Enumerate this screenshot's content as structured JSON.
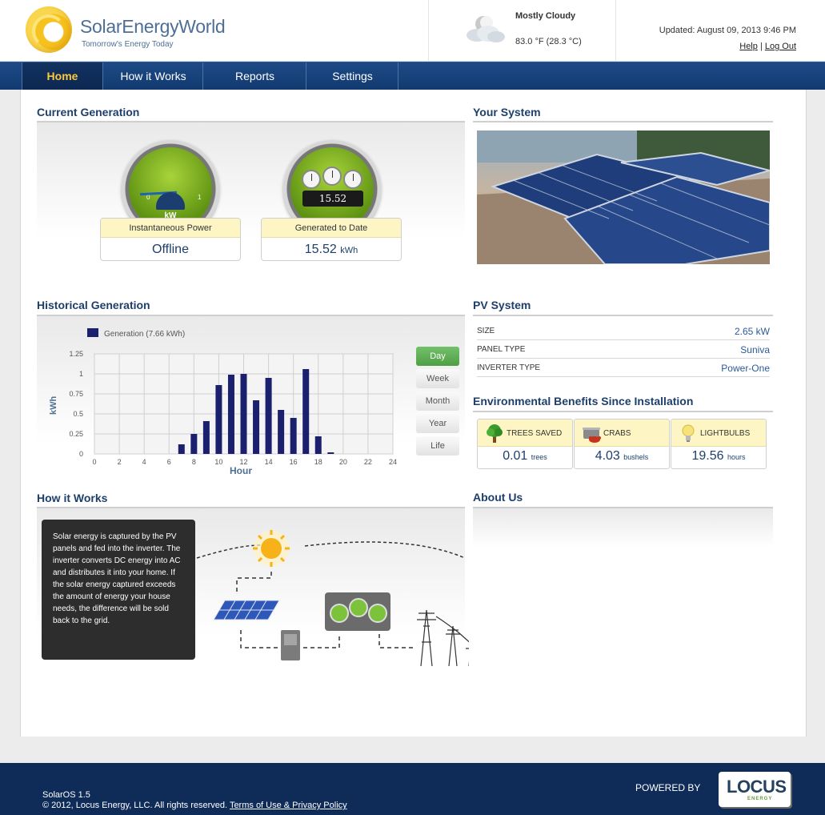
{
  "brand": {
    "name": "SolarEnergyWorld",
    "tagline": "Tomorrow's Energy Today"
  },
  "weather": {
    "icon": "partly-cloudy-night-icon",
    "condition": "Mostly Cloudy",
    "temperature": "83.0 °F (28.3 °C)"
  },
  "header": {
    "updated": "Updated: August 09, 2013 9:46 PM",
    "help": "Help",
    "separator": "|",
    "logout": "Log Out"
  },
  "nav": {
    "items": [
      {
        "label": "Home",
        "active": true
      },
      {
        "label": "How it Works",
        "active": false
      },
      {
        "label": "Reports",
        "active": false
      },
      {
        "label": "Settings",
        "active": false
      }
    ]
  },
  "current_generation": {
    "title": "Current Generation",
    "gauge_power": {
      "scale_min": "0",
      "scale_max": "1",
      "unit": "kW",
      "label": "Instantaneous Power",
      "value": "Offline"
    },
    "gauge_total": {
      "odometer": "15.52",
      "label": "Generated to Date",
      "value": "15.52",
      "unit": "kWh"
    }
  },
  "your_system": {
    "title": "Your System"
  },
  "historical": {
    "title": "Historical Generation",
    "ranges": [
      {
        "label": "Day",
        "active": true
      },
      {
        "label": "Week",
        "active": false
      },
      {
        "label": "Month",
        "active": false
      },
      {
        "label": "Year",
        "active": false
      },
      {
        "label": "Life",
        "active": false
      }
    ]
  },
  "chart_data": {
    "type": "bar",
    "legend": "Generation (7.66 kWh)",
    "xlabel": "Hour",
    "ylabel": "kWh",
    "xlim": [
      0,
      24
    ],
    "ylim": [
      0,
      1.25
    ],
    "x_ticks": [
      0,
      2,
      4,
      6,
      8,
      10,
      12,
      14,
      16,
      18,
      20,
      22,
      24
    ],
    "y_ticks": [
      "0",
      "0.25",
      "0.5",
      "0.75",
      "1",
      "1.25"
    ],
    "grid": true,
    "color": "#1a1f6e",
    "x": [
      7,
      8,
      9,
      10,
      11,
      12,
      13,
      14,
      15,
      16,
      17,
      18,
      19
    ],
    "values": [
      0.12,
      0.25,
      0.41,
      0.86,
      0.99,
      1.0,
      0.67,
      0.95,
      0.55,
      0.45,
      1.06,
      0.22,
      0.02
    ]
  },
  "pv_system": {
    "title": "PV System",
    "rows": [
      {
        "key": "SIZE",
        "value": "2.65 kW"
      },
      {
        "key": "PANEL TYPE",
        "value": "Suniva"
      },
      {
        "key": "INVERTER TYPE",
        "value": "Power-One"
      }
    ]
  },
  "environment": {
    "title": "Environmental Benefits Since Installation",
    "cards": [
      {
        "label": "TREES SAVED",
        "value": "0.01",
        "unit": "trees",
        "icon": "tree-icon"
      },
      {
        "label": "CRABS",
        "value": "4.03",
        "unit": "bushels",
        "icon": "crab-pot-icon"
      },
      {
        "label": "LIGHTBULBS",
        "value": "19.56",
        "unit": "hours",
        "icon": "lightbulb-icon"
      }
    ]
  },
  "how_it_works": {
    "title": "How it Works",
    "text": "Solar energy is captured by the PV panels and fed into the inverter. The inverter converts DC energy into AC and distributes it into your home. If the solar energy captured exceeds the amount of energy your house needs, the difference will be sold back to the grid."
  },
  "about_us": {
    "title": "About Us"
  },
  "footer": {
    "version": "SolarOS 1.5",
    "copyright": "© 2012, Locus Energy, LLC. All rights reserved.",
    "terms": "Terms of Use & Privacy Policy",
    "powered_by": "POWERED BY",
    "locus_word": "LOCUS",
    "locus_sub": "ENERGY"
  }
}
